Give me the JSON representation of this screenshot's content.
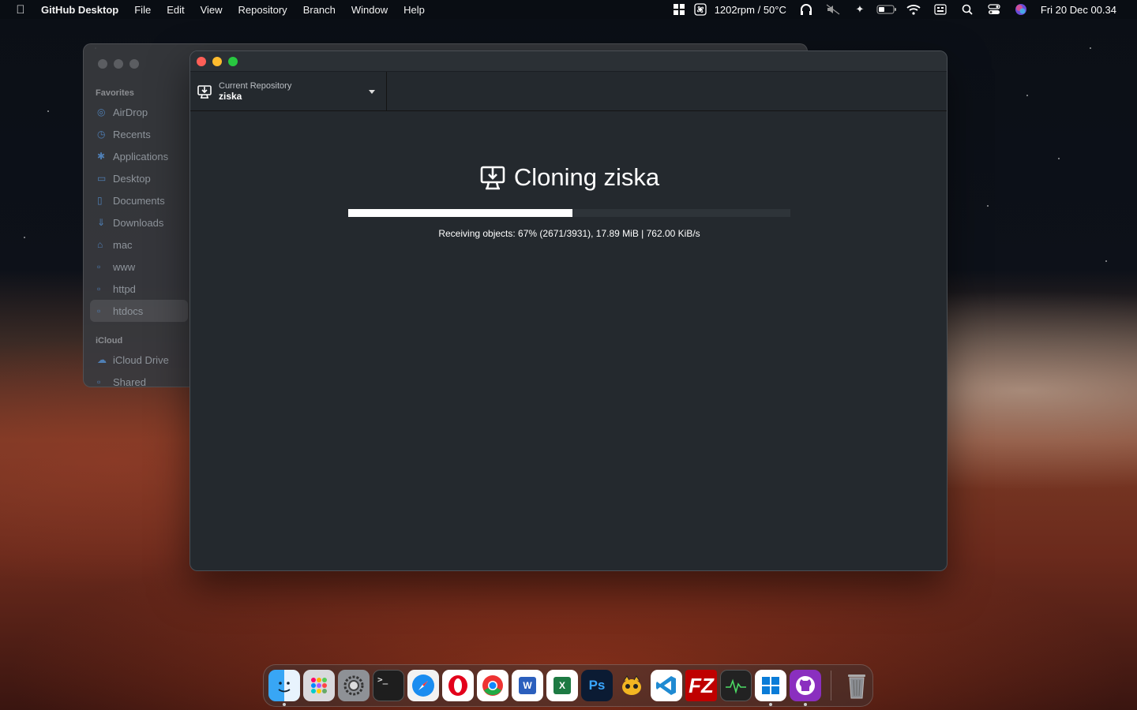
{
  "menubar": {
    "app_name": "GitHub Desktop",
    "items": [
      "File",
      "Edit",
      "View",
      "Repository",
      "Branch",
      "Window",
      "Help"
    ],
    "fan_status": "1202rpm / 50°C",
    "datetime": "Fri 20 Dec  00.34"
  },
  "finder": {
    "favorites_heading": "Favorites",
    "favorites": [
      "AirDrop",
      "Recents",
      "Applications",
      "Desktop",
      "Documents",
      "Downloads",
      "mac",
      "www",
      "httpd",
      "htdocs"
    ],
    "active_item": "htdocs",
    "icloud_heading": "iCloud",
    "icloud": [
      "iCloud Drive",
      "Shared"
    ]
  },
  "github": {
    "repo_label": "Current Repository",
    "repo_name": "ziska",
    "clone_title": "Cloning ziska",
    "progress_fraction": 0.507,
    "status": "Receiving objects: 67% (2671/3931), 17.89 MiB | 762.00 KiB/s"
  },
  "dock": {
    "apps": [
      "finder-icon",
      "launchpad-icon",
      "system-settings-icon",
      "terminal-icon",
      "safari-icon",
      "opera-icon",
      "chrome-icon",
      "word-icon",
      "excel-icon",
      "photoshop-icon",
      "navicat-icon",
      "vscode-icon",
      "filezilla-icon",
      "activity-monitor-icon",
      "windows-app-icon",
      "github-desktop-icon",
      "trash-icon"
    ]
  }
}
